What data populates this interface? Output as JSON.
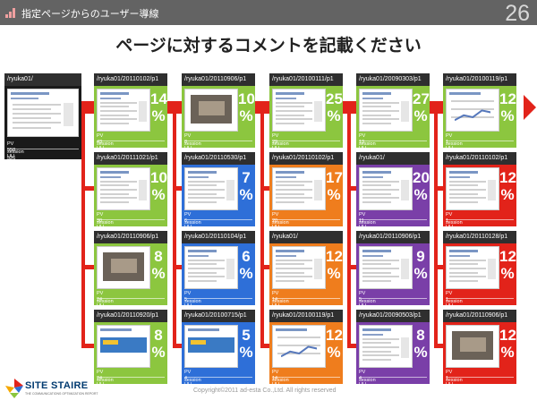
{
  "header": {
    "title": "指定ページからのユーザー導線",
    "page_number": "26"
  },
  "main_title": "ページに対するコメントを記載ください",
  "copyright": "Copyright©2011 ad-esta Co.,Ltd. All rights reserved",
  "logo": {
    "name": "SITE STAIRE",
    "tagline": "THE COMMUNICATIONS OPTIMIZATION REPORT"
  },
  "stat_labels": {
    "pv": "PV",
    "uu": "UU",
    "session": "session"
  },
  "colors": {
    "green": "#8cc63f",
    "blue": "#2e6fd8",
    "orange": "#ef7d1d",
    "purple": "#7a3fa8",
    "red": "#e2231a",
    "black": "#1a1a1a",
    "connector": "#e2231a"
  },
  "source": {
    "path": "/ryuka01/",
    "pv": "558",
    "uu": "512",
    "session": "526",
    "color": "black"
  },
  "columns": [
    [
      {
        "path": "/ryuka01/20110102/p1",
        "pct": "14",
        "pv": "43",
        "uu": "24",
        "session": "26",
        "color": "green",
        "thumb": "site"
      },
      {
        "path": "/ryuka01/20111021/p1",
        "pct": "10",
        "pv": "30",
        "uu": "23",
        "session": "30",
        "color": "green",
        "thumb": "site"
      },
      {
        "path": "/ryuka01/20110906/p1",
        "pct": "8",
        "pv": "24",
        "uu": "13",
        "session": "21",
        "color": "green",
        "thumb": "photo"
      },
      {
        "path": "/ryuka01/20110920/p1",
        "pct": "8",
        "pv": "24",
        "uu": "24",
        "session": "25",
        "color": "green",
        "thumb": "banner"
      }
    ],
    [
      {
        "path": "/ryuka01/20110906/p1",
        "pct": "10",
        "pv": "8",
        "uu": "2",
        "session": "2",
        "color": "green",
        "thumb": "photo"
      },
      {
        "path": "/ryuka01/20110530/p1",
        "pct": "7",
        "pv": "6",
        "uu": "5",
        "session": "5",
        "color": "blue",
        "thumb": "site"
      },
      {
        "path": "/ryuka01/20110104/p1",
        "pct": "6",
        "pv": "5",
        "uu": "5",
        "session": "5",
        "color": "blue",
        "thumb": "site"
      },
      {
        "path": "/ryuka01/20100715/p1",
        "pct": "5",
        "pv": "4",
        "uu": "4",
        "session": "4",
        "color": "blue",
        "thumb": "banner"
      }
    ],
    [
      {
        "path": "/ryuka01/20100111/p1",
        "pct": "25",
        "pv": "29",
        "uu": "20",
        "session": "32",
        "color": "green",
        "thumb": "site"
      },
      {
        "path": "/ryuka01/20110102/p1",
        "pct": "17",
        "pv": "20",
        "uu": "3",
        "session": "2",
        "color": "orange",
        "thumb": "site"
      },
      {
        "path": "/ryuka01/",
        "pct": "12",
        "pv": "14",
        "uu": "13",
        "session": "14",
        "color": "orange",
        "thumb": "site"
      },
      {
        "path": "/ryuka01/20100119/p1",
        "pct": "12",
        "pv": "14",
        "uu": "13",
        "session": "14",
        "color": "orange",
        "thumb": "chart"
      }
    ],
    [
      {
        "path": "/ryuka01/20090303/p1",
        "pct": "27",
        "pv": "13",
        "uu": "14",
        "session": "15",
        "color": "green",
        "thumb": "site"
      },
      {
        "path": "/ryuka01/",
        "pct": "20",
        "pv": "11",
        "uu": "6",
        "session": "6",
        "color": "purple",
        "thumb": "site"
      },
      {
        "path": "/ryuka01/20110906/p1",
        "pct": "9",
        "pv": "5",
        "uu": "5",
        "session": "5",
        "color": "purple",
        "thumb": "site"
      },
      {
        "path": "/ryuka01/20090503/p1",
        "pct": "8",
        "pv": "4",
        "uu": "4",
        "session": "4",
        "color": "purple",
        "thumb": "site"
      }
    ],
    [
      {
        "path": "/ryuka01/20100119/p1",
        "pct": "12",
        "pv": "1",
        "uu": "1",
        "session": "1",
        "color": "green",
        "thumb": "chart"
      },
      {
        "path": "/ryuka01/20110102/p1",
        "pct": "12",
        "pv": "1",
        "uu": "1",
        "session": "1",
        "color": "red",
        "thumb": "site"
      },
      {
        "path": "/ryuka01/20110128/p1",
        "pct": "12",
        "pv": "1",
        "uu": "1",
        "session": "1",
        "color": "red",
        "thumb": "site"
      },
      {
        "path": "/ryuka01/20110906/p1",
        "pct": "12",
        "pv": "1",
        "uu": "1",
        "session": "1",
        "color": "red",
        "thumb": "photo"
      }
    ]
  ]
}
